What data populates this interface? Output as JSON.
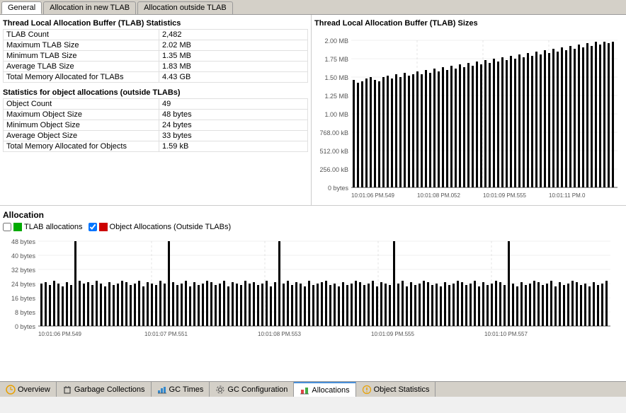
{
  "tabs_top": [
    {
      "label": "General",
      "active": true
    },
    {
      "label": "Allocation in new TLAB",
      "active": false
    },
    {
      "label": "Allocation outside TLAB",
      "active": false
    }
  ],
  "tlab_stats": {
    "title": "Thread Local Allocation Buffer (TLAB) Statistics",
    "rows": [
      {
        "label": "TLAB Count",
        "value": "2,482"
      },
      {
        "label": "Maximum TLAB Size",
        "value": "2.02 MB"
      },
      {
        "label": "Minimum TLAB Size",
        "value": "1.35 MB"
      },
      {
        "label": "Average TLAB Size",
        "value": "1.83 MB"
      },
      {
        "label": "Total Memory Allocated for TLABs",
        "value": "4.43 GB"
      }
    ]
  },
  "object_stats": {
    "title": "Statistics for object allocations (outside TLABs)",
    "rows": [
      {
        "label": "Object Count",
        "value": "49"
      },
      {
        "label": "Maximum Object Size",
        "value": "48 bytes"
      },
      {
        "label": "Minimum Object Size",
        "value": "24 bytes"
      },
      {
        "label": "Average Object Size",
        "value": "33 bytes"
      },
      {
        "label": "Total Memory Allocated for Objects",
        "value": "1.59 kB"
      }
    ]
  },
  "tlab_chart": {
    "title": "Thread Local Allocation Buffer (TLAB) Sizes",
    "y_labels": [
      "2.00 MB",
      "1.75 MB",
      "1.50 MB",
      "1.25 MB",
      "1.00 MB",
      "768.00 kB",
      "512.00 kB",
      "256.00 kB",
      "0 bytes"
    ],
    "x_labels": [
      "10:01:06 PM.549",
      "10:01:08 PM.052",
      "10:01:09 PM.555",
      "10:01:11 PM.0"
    ]
  },
  "allocation_section": {
    "title": "Allocation",
    "legend": [
      {
        "label": "TLAB allocations",
        "color": "#00aa00",
        "checked": false
      },
      {
        "label": "Object Allocations (Outside TLABs)",
        "color": "#cc0000",
        "checked": true
      }
    ],
    "chart": {
      "y_labels": [
        "48 bytes",
        "40 bytes",
        "32 bytes",
        "24 bytes",
        "16 bytes",
        "8 bytes",
        "0 bytes"
      ],
      "x_labels": [
        "10:01:06 PM.549",
        "10:01:07 PM.551",
        "10:01:08 PM.553",
        "10:01:09 PM.555",
        "10:01:10 PM.557"
      ]
    }
  },
  "bottom_tabs": [
    {
      "label": "Overview",
      "icon": "clock",
      "active": false
    },
    {
      "label": "Garbage Collections",
      "icon": "trash",
      "active": false
    },
    {
      "label": "GC Times",
      "icon": "chart",
      "active": false
    },
    {
      "label": "GC Configuration",
      "icon": "gear",
      "active": false
    },
    {
      "label": "Allocations",
      "icon": "alloc",
      "active": true
    },
    {
      "label": "Object Statistics",
      "icon": "stats",
      "active": false
    }
  ]
}
